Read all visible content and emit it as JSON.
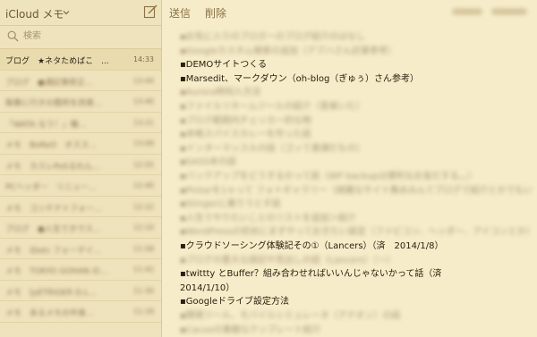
{
  "header": {
    "app_title": "iCloud メモ",
    "chevron_icon": "chevron-down-icon",
    "compose_icon": "compose-icon"
  },
  "search": {
    "placeholder": "検索",
    "icon": "search-icon"
  },
  "note_list": [
    {
      "text": "ブログ　★ネタためばこ　...",
      "time": "14:33",
      "selected": true,
      "blurred": false
    },
    {
      "text": "ブログ　●通記事修正…",
      "time": "13:44",
      "selected": false,
      "blurred": true
    },
    {
      "text": "執筆に行きの箇所を改善…",
      "time": "13:40",
      "selected": false,
      "blurred": true
    },
    {
      "text": "「WATA なう！」機…",
      "time": "13:21",
      "selected": false,
      "blurred": true
    },
    {
      "text": "メモ　BoReO　オスス…",
      "time": "13:09",
      "selected": false,
      "blurred": true
    },
    {
      "text": "メモ　カスレPoSるれん…",
      "time": "12:55",
      "selected": false,
      "blurred": true
    },
    {
      "text": "PCヘッダー　リニュー…",
      "time": "12:40",
      "selected": false,
      "blurred": true
    },
    {
      "text": "メモ　コンテナトフォー…",
      "time": "12:22",
      "selected": false,
      "blurred": true
    },
    {
      "text": "ブログ　●人生できウス…",
      "time": "12:10",
      "selected": false,
      "blurred": true
    },
    {
      "text": "メモ　iDotc フォーデイ…",
      "time": "11:58",
      "selected": false,
      "blurred": true
    },
    {
      "text": "メモ　TOKYO GOHAN の…",
      "time": "11:42",
      "selected": false,
      "blurred": true
    },
    {
      "text": "メモ　[pETRIGER D.L…",
      "time": "11:30",
      "selected": false,
      "blurred": true
    },
    {
      "text": "メモ　あるメモの中身…",
      "time": "11:18",
      "selected": false,
      "blurred": true
    }
  ],
  "toolbar": {
    "send_label": "送信",
    "delete_label": "削除"
  },
  "note_lines": [
    {
      "text": "▪お気に入りのブロガーのブログ紹介のはなし",
      "blur": true
    },
    {
      "text": "▪Googleカスタム検索の追加（アブハさん記事参考）",
      "blur": true
    },
    {
      "text": "▪DEMOサイトつくる",
      "blur": false
    },
    {
      "text": "▪Marsedit、マークダウン（oh-blog（ぎゅぅ）さん参考）",
      "blur": false
    },
    {
      "text": "▪Aurora時刻入方法",
      "blur": true
    },
    {
      "text": "▪ファイルリネームツールの紹介（音楽いた）",
      "blur": true
    },
    {
      "text": "▪ブログ範囲内チェッカー的な物",
      "blur": true
    },
    {
      "text": "▪本格スパイスカレーを作った話",
      "blur": true
    },
    {
      "text": "▪インターマッスルの話（ゴッて普通だもの）",
      "blur": true
    },
    {
      "text": "▪SASS本の話",
      "blur": true
    },
    {
      "text": "▪バックアップをどうするかって話（WP backupは便利なお金だする。。）",
      "blur": true
    },
    {
      "text": "▪Pintarを1ゃって フォトギャラリー（綺麗なサイト集めみんてブログで紹介とかでもいいかも）",
      "blur": true
    },
    {
      "text": "▪Stingerに乗りうとす話",
      "blur": true
    },
    {
      "text": "▪人生でやりたいことのリストを追加＞紹介",
      "blur": true
    },
    {
      "text": "▪WordPressの初めにまずやっておきたい設定（ファビコン、ヘッダー、アイコンとか）",
      "blur": true
    },
    {
      "text": "▪クラウドソーシング体験記その①（Lancers）（済　2014/1/8）",
      "blur": false
    },
    {
      "text": "▪ブログの重大な誤記や見出しの話（Lancers）（〜）",
      "blur": true
    },
    {
      "text": "▪twittty とBuffer？組み合わせればいいんじゃないかって話（済",
      "blur": false
    },
    {
      "text": "2014/1/10）",
      "blur": false
    },
    {
      "text": "▪Googleドライブ設定方法",
      "blur": false
    },
    {
      "text": "▪開発ツール、モバイルシミュレータ（アナオン）の話",
      "blur": true
    },
    {
      "text": "▪Cacooの素敵なテンプレート紹介",
      "blur": true
    }
  ]
}
